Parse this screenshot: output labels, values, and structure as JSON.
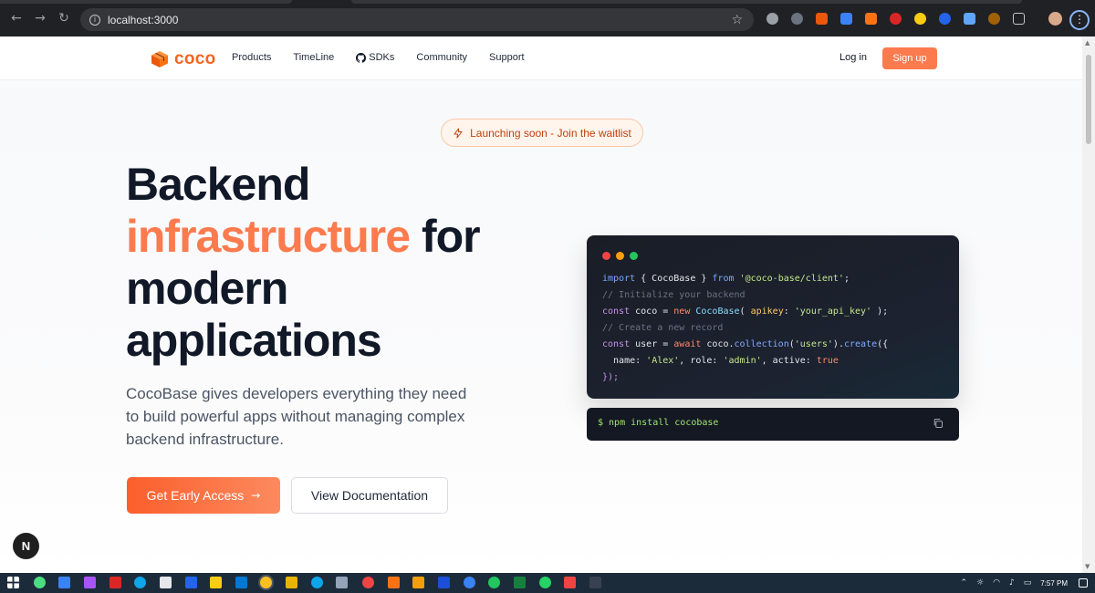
{
  "browser": {
    "url": "localhost:3000"
  },
  "header": {
    "logo_text": "coco",
    "nav": [
      {
        "label": "Products"
      },
      {
        "label": "TimeLine"
      },
      {
        "label": "SDKs"
      },
      {
        "label": "Community"
      },
      {
        "label": "Support"
      }
    ],
    "login_label": "Log in",
    "signup_label": "Sign up"
  },
  "hero": {
    "badge_text": "Launching soon - Join the waitlist",
    "title_line1": "Backend",
    "title_accent": "infrastructure",
    "title_after_accent": " for",
    "title_line3": "modern",
    "title_line4": "applications",
    "description": "CocoBase gives developers everything they need to build powerful apps without managing complex backend infrastructure.",
    "primary_cta": "Get Early Access",
    "secondary_cta": "View Documentation"
  },
  "code_sample": {
    "lines": [
      "import { CocoBase } from '@coco-base/client';",
      "// Initialize your backend",
      "const coco = new CocoBase( apikey: 'your_api_key' );",
      "// Create a new record",
      "const user = await coco.collection('users').create({",
      "  name: 'Alex', role: 'admin', active: true",
      "});"
    ],
    "install_command": "$ npm install cocobase"
  },
  "dev_indicator": "N",
  "taskbar": {
    "time": "7:57 PM"
  },
  "colors": {
    "accent": "#fb7b4e",
    "title_dark": "#111827",
    "code_bg": "#1a1d26"
  }
}
